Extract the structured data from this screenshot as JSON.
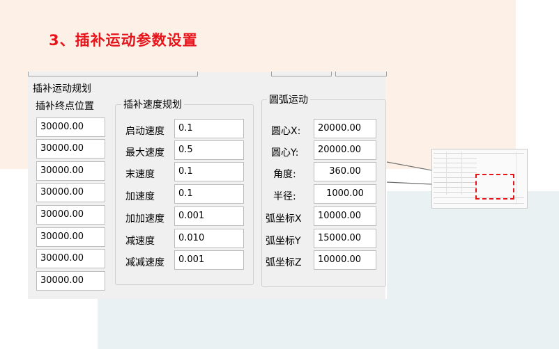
{
  "page": {
    "title": "3、插补运动参数设置",
    "title_color": "#e8141b"
  },
  "dialog": {
    "title": "插补运动规划",
    "endpoint_panel": {
      "title": "插补终点位置",
      "values": [
        "30000.00",
        "30000.00",
        "30000.00",
        "30000.00",
        "30000.00",
        "30000.00",
        "30000.00",
        "30000.00"
      ]
    },
    "speed_group": {
      "title": "插补速度规划",
      "rows": [
        {
          "label": "启动速度",
          "value": "0.1"
        },
        {
          "label": "最大速度",
          "value": "0.5"
        },
        {
          "label": "末速度",
          "value": "0.1"
        },
        {
          "label": "加速度",
          "value": "0.1"
        },
        {
          "label": "加加速度",
          "value": "0.001"
        },
        {
          "label": "减速度",
          "value": "0.010"
        },
        {
          "label": "减减速度",
          "value": "0.001"
        }
      ]
    },
    "arc_group": {
      "title": "圆弧运动",
      "rows": [
        {
          "label": "圆心X:",
          "value": "20000.00"
        },
        {
          "label": "圆心Y:",
          "value": "20000.00"
        },
        {
          "label": "角度:",
          "value": "360.00"
        },
        {
          "label": "半径:",
          "value": "1000.00"
        },
        {
          "label": "弧坐标X",
          "value": "10000.00"
        },
        {
          "label": "弧坐标Y",
          "value": "15000.00"
        },
        {
          "label": "弧坐标Z",
          "value": "10000.00"
        }
      ]
    }
  },
  "thumbnail": {
    "highlight_color": "#e8141b"
  }
}
